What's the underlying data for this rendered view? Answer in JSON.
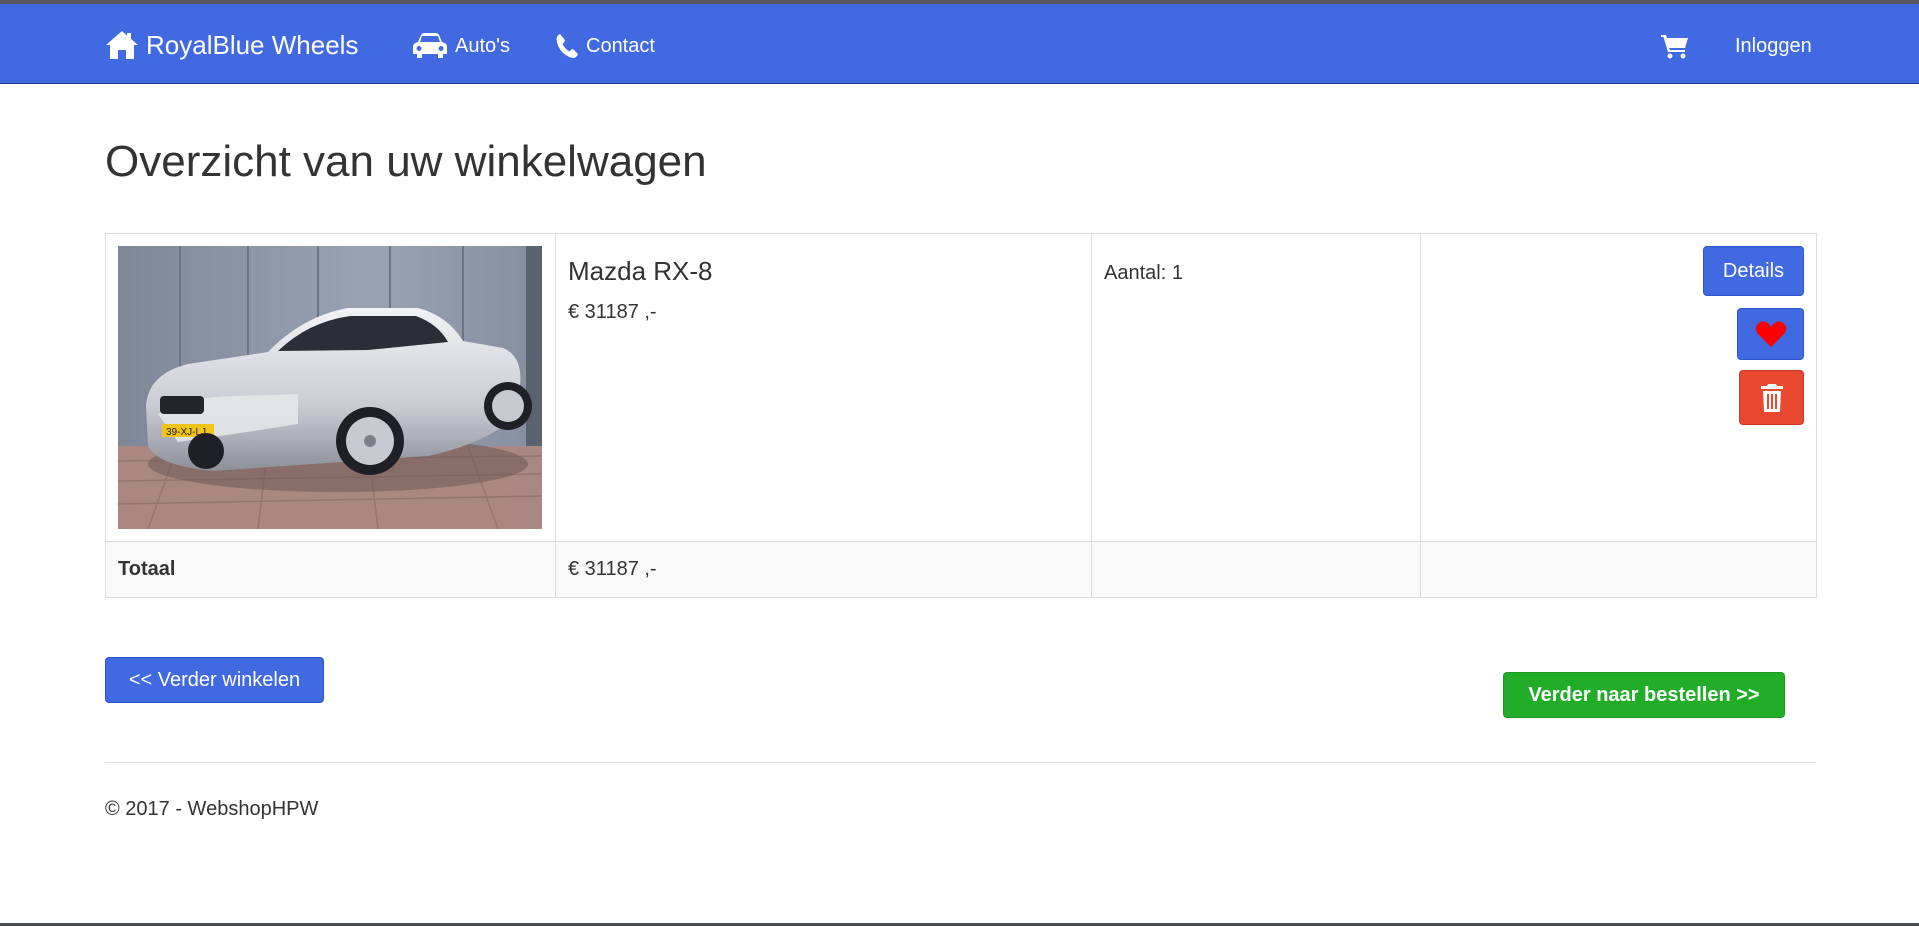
{
  "nav": {
    "brand": "RoyalBlue Wheels",
    "brand_icon": "home-icon",
    "autos_label": "Auto's",
    "autos_icon": "car-icon",
    "contact_label": "Contact",
    "contact_icon": "phone-icon",
    "cart_icon": "shopping-cart-icon",
    "login_label": "Inloggen"
  },
  "page": {
    "title": "Overzicht van uw winkelwagen"
  },
  "cart": {
    "items": [
      {
        "name": "Mazda RX-8",
        "price": "€ 31187 ,-",
        "quantity": "Aantal: 1",
        "image": "silver convertible car photo",
        "details_label": "Details",
        "favorite_icon": "heart-icon",
        "delete_icon": "trash-icon"
      }
    ],
    "total_label": "Totaal",
    "total_value": "€ 31187 ,-"
  },
  "actions": {
    "continue_label": "<< Verder winkelen",
    "order_label": "Verder naar bestellen >>"
  },
  "footer": {
    "text": "© 2017 - WebshopHPW"
  },
  "colors": {
    "navbar": "#4169e1",
    "primary_button": "#4169e1",
    "delete_button": "#e8492e",
    "order_button": "#21ad27",
    "heart": "#ff0000"
  }
}
